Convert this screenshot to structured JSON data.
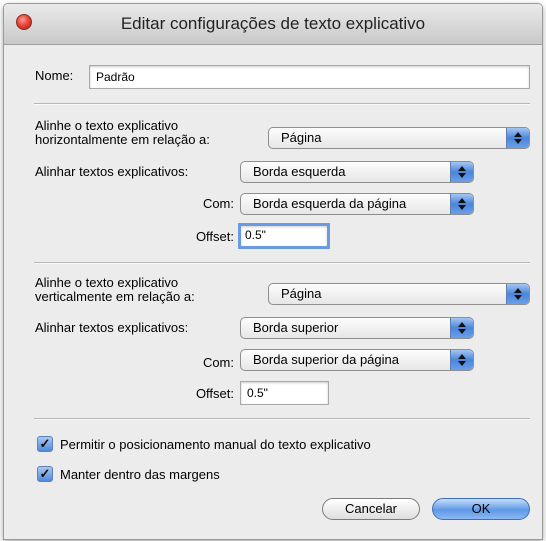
{
  "window": {
    "title": "Editar configurações de texto explicativo"
  },
  "name": {
    "label": "Nome:",
    "value": "Padrão"
  },
  "horizontal": {
    "relative_label_line1": "Alinhe o texto explicativo",
    "relative_label_line2": "horizontalmente em relação a:",
    "relative_value": "Página",
    "align_label": "Alinhar textos explicativos:",
    "align_value": "Borda esquerda",
    "with_label": "Com:",
    "with_value": "Borda esquerda da página",
    "offset_label": "Offset:",
    "offset_value": "0.5\""
  },
  "vertical": {
    "relative_label_line1": "Alinhe o texto explicativo",
    "relative_label_line2": "verticalmente em relação a:",
    "relative_value": "Página",
    "align_label": "Alinhar textos explicativos:",
    "align_value": "Borda superior",
    "with_label": "Com:",
    "with_value": "Borda superior da página",
    "offset_label": "Offset:",
    "offset_value": "0.5\""
  },
  "options": {
    "manual_label": "Permitir o posicionamento manual do texto explicativo",
    "manual_checked": true,
    "margins_label": "Manter dentro das margens",
    "margins_checked": true
  },
  "buttons": {
    "cancel": "Cancelar",
    "ok": "OK"
  }
}
